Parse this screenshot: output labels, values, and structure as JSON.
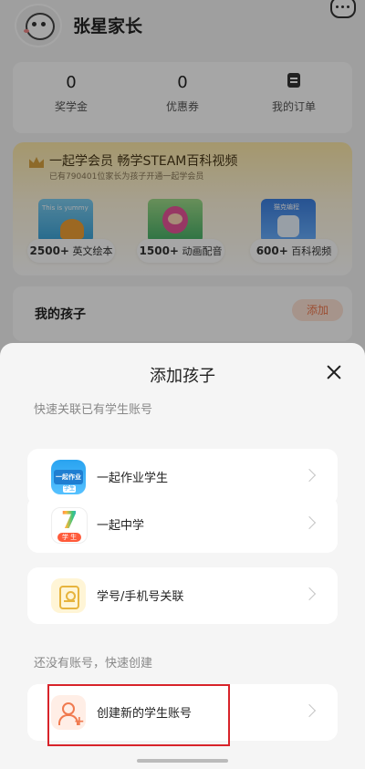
{
  "header": {
    "username": "张星家长"
  },
  "stats": [
    {
      "value": "0",
      "label": "奖学金"
    },
    {
      "value": "0",
      "label": "优惠券"
    },
    {
      "value": "",
      "label": "我的订单",
      "icon": "order-icon"
    }
  ],
  "vip": {
    "title": "一起学会员 畅学STEAM百科视频",
    "subtitle": "已有790401位家长为孩子开通一起学会员",
    "cards": [
      {
        "count": "2500+",
        "label": "英文绘本",
        "thumb_text": "This is yummy"
      },
      {
        "count": "1500+",
        "label": "动画配音"
      },
      {
        "count": "600+",
        "label": "百科视频",
        "thumb_text": "猫克编程"
      }
    ]
  },
  "kids": {
    "title": "我的孩子",
    "add_label": "添加"
  },
  "sheet": {
    "title": "添加孩子",
    "quick_section_label": "快速关联已有学生账号",
    "quick_items": [
      {
        "label": "一起作业学生",
        "icon": "yiqi-zuoye-app-icon",
        "icon_text": "一起作业",
        "icon_tag": "学生"
      },
      {
        "label": "一起中学",
        "icon": "yiqi-zhongxue-app-icon",
        "icon_text": "7",
        "icon_tag": "学 生"
      },
      {
        "label": "学号/手机号关联",
        "icon": "id-card-icon"
      }
    ],
    "create_section_label": "还没有账号，快速创建",
    "create_item": {
      "label": "创建新的学生账号",
      "icon": "add-user-icon"
    }
  },
  "colors": {
    "accent": "#f07a4f",
    "highlight": "#d8232a",
    "vip_gold": "#fde9a8"
  }
}
